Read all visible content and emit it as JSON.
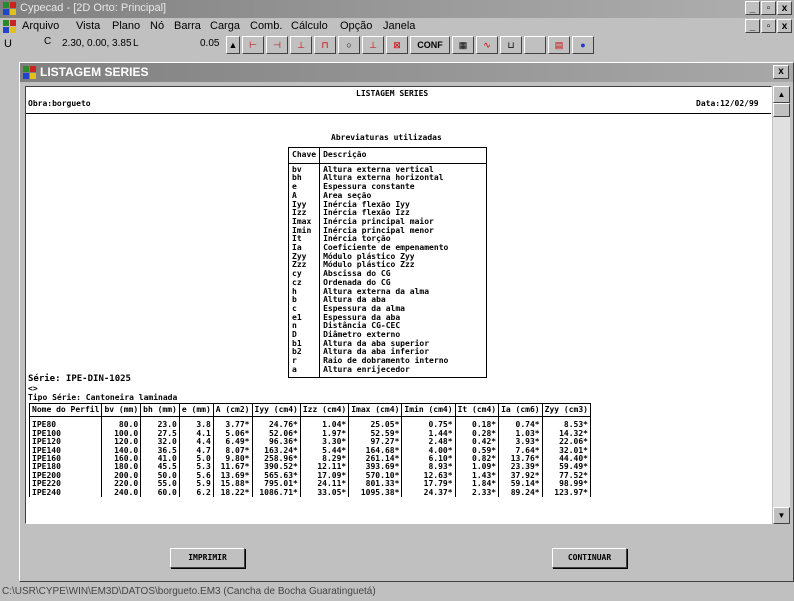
{
  "window": {
    "title": "Cypecad - [2D Orto: Principal]",
    "minimize": "_",
    "restore": "▫",
    "close": "x"
  },
  "menu": [
    {
      "label": "Arquivo"
    },
    {
      "label": "Vista"
    },
    {
      "label": "Plano"
    },
    {
      "label": "Nó"
    },
    {
      "label": "Barra"
    },
    {
      "label": "Carga"
    },
    {
      "label": "Comb."
    },
    {
      "label": "Cálculo"
    },
    {
      "label": "Opção"
    },
    {
      "label": "Janela"
    }
  ],
  "toolbar": {
    "left": "U",
    "coords": "2.30, 0.00, 3.85",
    "l_label": "L",
    "value": "0.05",
    "conf": "CONF"
  },
  "dialog": {
    "title": "LISTAGEM SERIES",
    "close": "x",
    "report": {
      "heading": "LISTAGEM SERIES",
      "obra": "Obra:borgueto",
      "data": "Data:12/02/99",
      "abbr_title": "Abreviaturas utilizadas",
      "abbr_header": {
        "key": "Chave",
        "desc": "Descrição"
      },
      "abbr_keys": "bv\nbh\ne\nA\nIyy\nIzz\nImax\nImin\nIt\nIa\nZyy\nZzz\ncy\ncz\nh\nb\nc\ne1\nn\nD\nb1\nb2\nr\na",
      "abbr_descs": "Altura externa vertical\nAltura externa horizontal\nEspessura constante\nArea seção\nInércia flexão Iyy\nInércia flexão Izz\nInércia principal maior\nInércia principal menor\nInércia torção\nCoeficiente de empenamento\nMódulo plástico Zyy\nMódulo plástico Zzz\nAbscissa do CG\nOrdenada do CG\nAltura externa da alma\nAltura da aba\nEspessura da alma\nEspessura da aba\nDistância CG-CEC\nDiâmetro externo\nAltura da aba superior\nAltura da aba inferior\nRaio de dobramento interno\nAltura enrijecedor",
      "serie": "Série: IPE-DIN-1025",
      "brackets": "<>",
      "tipo": "Tipo Série: Cantoneira laminada",
      "columns": [
        "Nome do Perfil",
        "bv (mm)",
        "bh (mm)",
        "e (mm)",
        "A (cm2)",
        "Iyy (cm4)",
        "Izz (cm4)",
        "Imax (cm4)",
        "Imin (cm4)",
        "It (cm4)",
        "Ia (cm6)",
        "Zyy (cm3)"
      ],
      "rows": [
        [
          "IPE80",
          "80.0",
          "23.0",
          "3.8",
          "3.77*",
          "24.76*",
          "1.04*",
          "25.05*",
          "0.75*",
          "0.18*",
          "0.74*",
          "8.53*"
        ],
        [
          "IPE100",
          "100.0",
          "27.5",
          "4.1",
          "5.06*",
          "52.06*",
          "1.97*",
          "52.59*",
          "1.44*",
          "0.28*",
          "1.03*",
          "14.32*"
        ],
        [
          "IPE120",
          "120.0",
          "32.0",
          "4.4",
          "6.49*",
          "96.36*",
          "3.30*",
          "97.27*",
          "2.48*",
          "0.42*",
          "3.93*",
          "22.06*"
        ],
        [
          "IPE140",
          "140.0",
          "36.5",
          "4.7",
          "8.07*",
          "163.24*",
          "5.44*",
          "164.68*",
          "4.00*",
          "0.59*",
          "7.64*",
          "32.01*"
        ],
        [
          "IPE160",
          "160.0",
          "41.0",
          "5.0",
          "9.80*",
          "258.96*",
          "8.29*",
          "261.14*",
          "6.10*",
          "0.82*",
          "13.76*",
          "44.40*"
        ],
        [
          "IPE180",
          "180.0",
          "45.5",
          "5.3",
          "11.67*",
          "390.52*",
          "12.11*",
          "393.69*",
          "8.93*",
          "1.09*",
          "23.39*",
          "59.49*"
        ],
        [
          "IPE200",
          "200.0",
          "50.0",
          "5.6",
          "13.69*",
          "565.63*",
          "17.09*",
          "570.10*",
          "12.63*",
          "1.43*",
          "37.92*",
          "77.52*"
        ],
        [
          "IPE220",
          "220.0",
          "55.0",
          "5.9",
          "15.88*",
          "795.01*",
          "24.11*",
          "801.33*",
          "17.79*",
          "1.84*",
          "59.14*",
          "98.99*"
        ],
        [
          "IPE240",
          "240.0",
          "60.0",
          "6.2",
          "18.22*",
          "1086.71*",
          "33.05*",
          "1095.38*",
          "24.37*",
          "2.33*",
          "89.24*",
          "123.97*"
        ]
      ]
    },
    "imprimir": "IMPRIMIR",
    "continuar": "CONTINUAR"
  },
  "status": "C:\\USR\\CYPE\\WIN\\EM3D\\DATOS\\borgueto.EM3 (Cancha de Bocha Guaratinguetá)"
}
